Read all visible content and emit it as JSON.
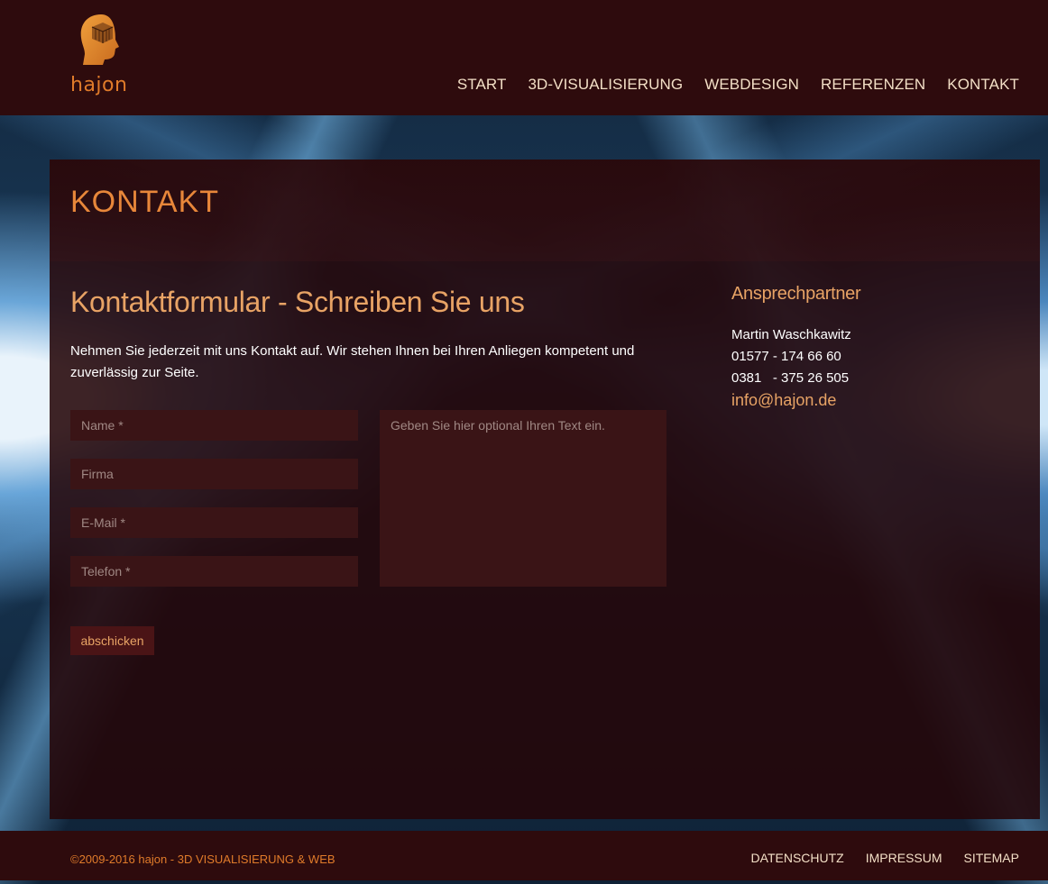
{
  "header": {
    "logo_text": "hajon",
    "nav": [
      "START",
      "3D-VISUALISIERUNG",
      "WEBDESIGN",
      "REFERENZEN",
      "KONTAKT"
    ]
  },
  "page": {
    "title": "KONTAKT",
    "form_heading": "Kontaktformular - Schreiben Sie uns",
    "intro": "Nehmen Sie jederzeit mit uns Kontakt auf. Wir stehen Ihnen bei Ihren Anliegen kompetent und zuverlässig zur Seite."
  },
  "form": {
    "name_placeholder": "Name *",
    "company_placeholder": "Firma",
    "email_placeholder": "E-Mail *",
    "phone_placeholder": "Telefon *",
    "message_placeholder": "Geben Sie hier optional Ihren Text ein.",
    "submit_label": "abschicken"
  },
  "contact": {
    "title": "Ansprechpartner",
    "name": "Martin Waschkawitz",
    "mobile": "01577 - 174 66 60",
    "phone": "0381   - 375 26 505",
    "email": "info@hajon.de"
  },
  "footer": {
    "copyright": "©2009-2016 hajon - 3D VISUALISIERUNG & WEB",
    "links": [
      "DATENSCHUTZ",
      "IMPRESSUM",
      "SITEMAP"
    ]
  },
  "colors": {
    "accent": "#e8873a",
    "header_bg": "#2e0b0d",
    "field_bg": "#3a1416"
  }
}
